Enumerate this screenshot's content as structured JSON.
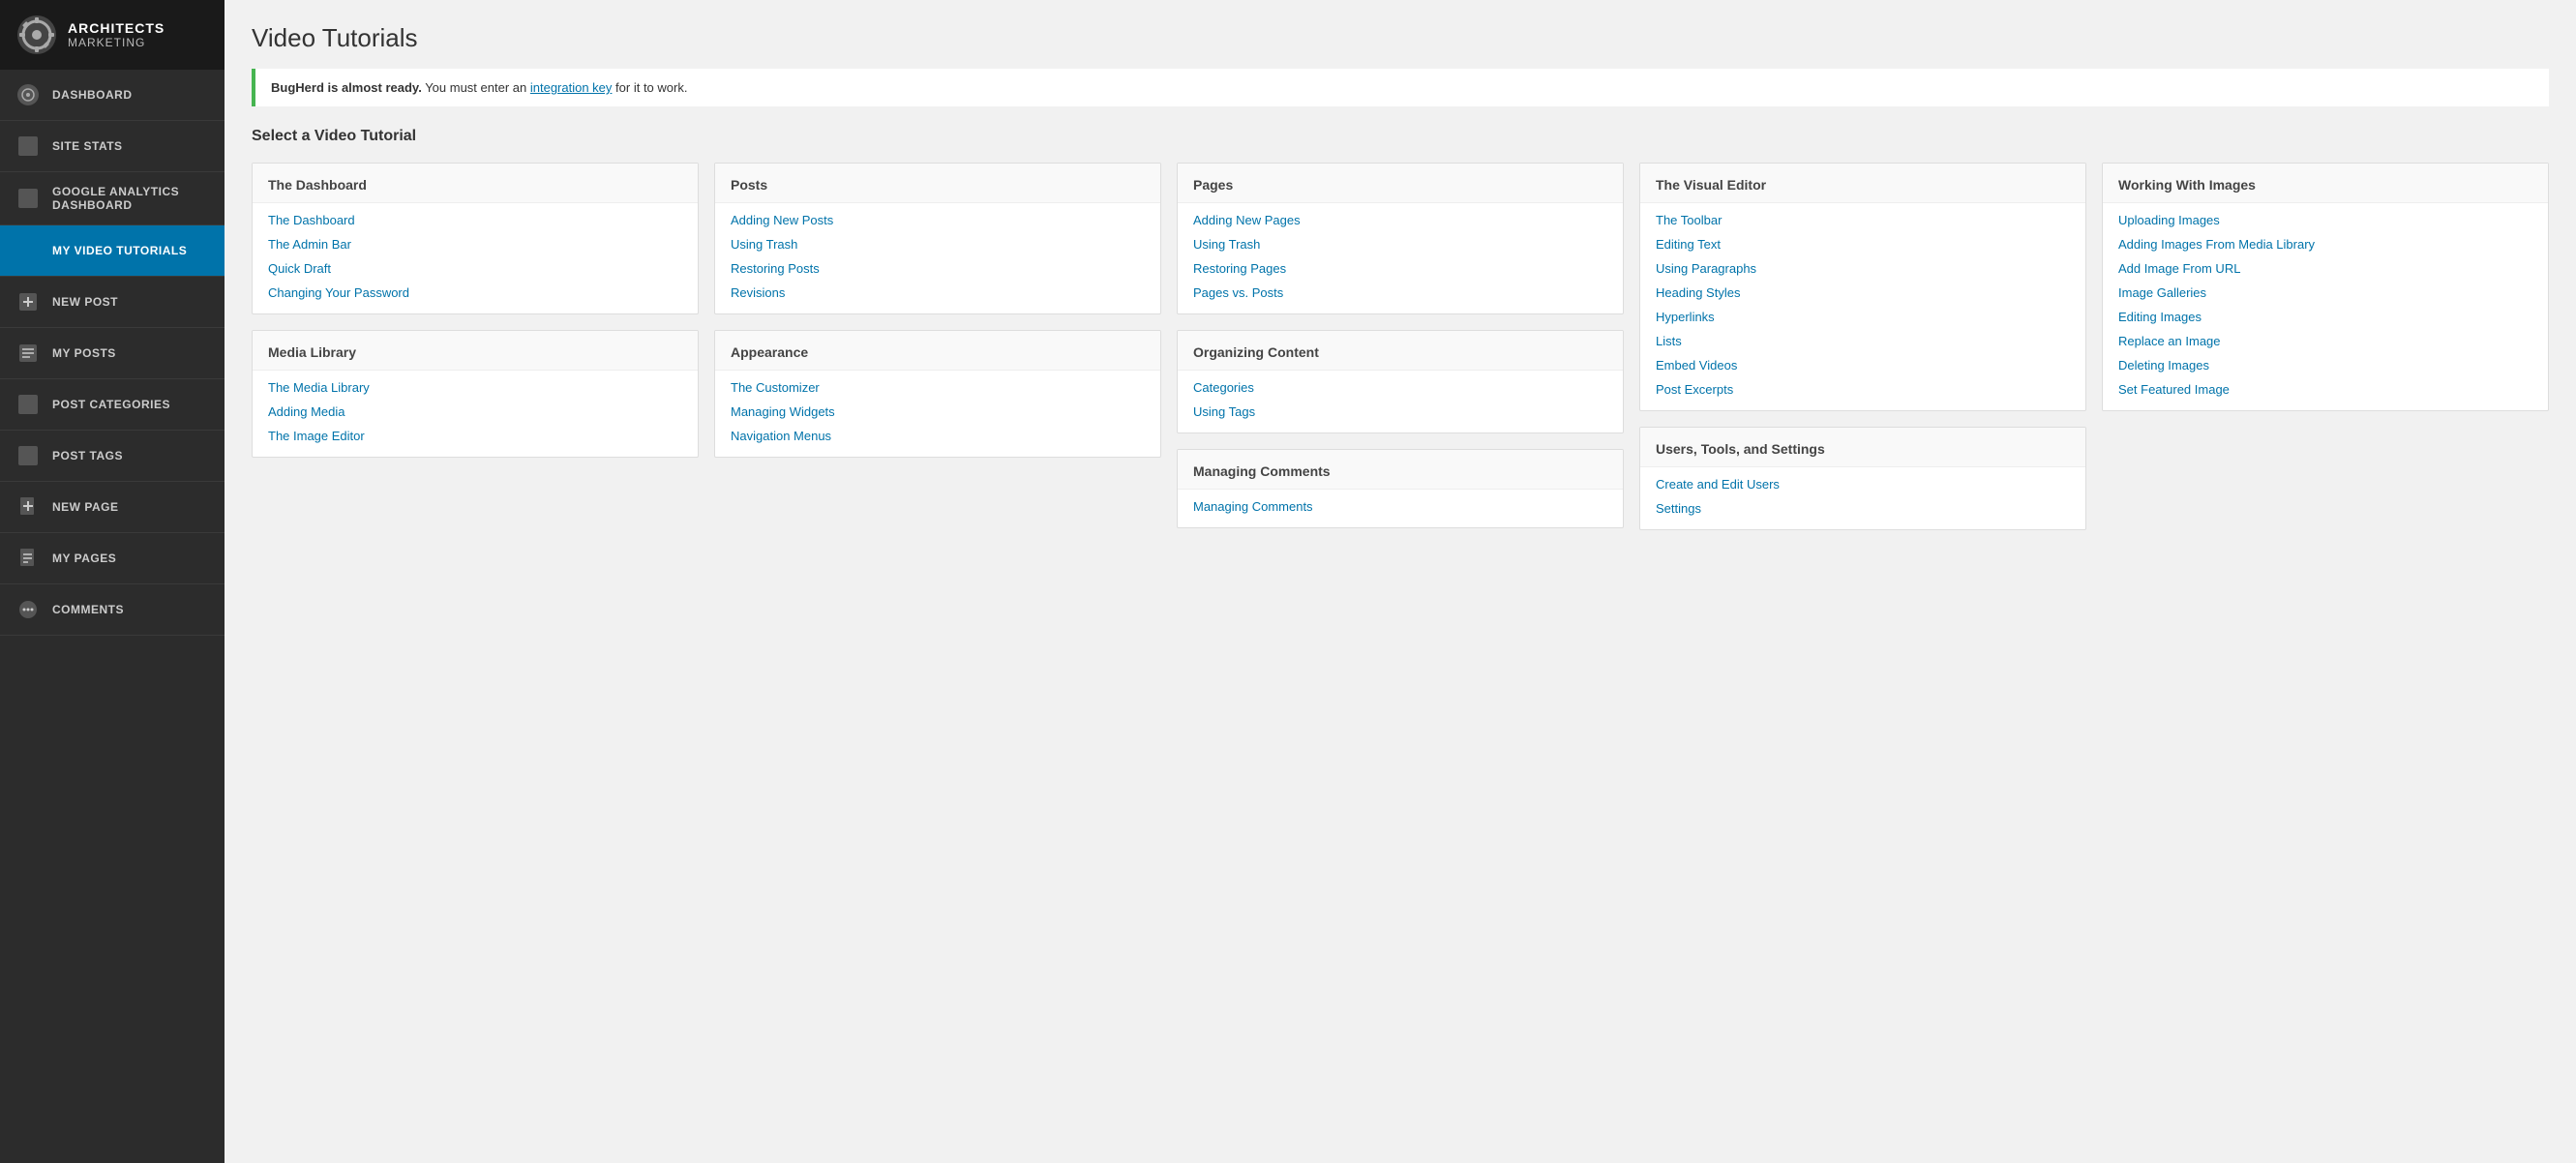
{
  "sidebar": {
    "logo": {
      "line1": "ARCHITECTS",
      "line2": "MARKETING"
    },
    "items": [
      {
        "id": "dashboard",
        "label": "DASHBOARD",
        "icon": "dashboard-icon",
        "active": false
      },
      {
        "id": "site-stats",
        "label": "SITE STATS",
        "icon": "site-stats-icon",
        "active": false
      },
      {
        "id": "google-analytics",
        "label": "GOOGLE ANALYTICS DASHBOARD",
        "icon": "analytics-icon",
        "active": false
      },
      {
        "id": "my-video-tutorials",
        "label": "MY VIDEO TUTORIALS",
        "icon": "video-icon",
        "active": true
      },
      {
        "id": "new-post",
        "label": "NEW POST",
        "icon": "new-post-icon",
        "active": false
      },
      {
        "id": "my-posts",
        "label": "MY POSTS",
        "icon": "my-posts-icon",
        "active": false
      },
      {
        "id": "post-categories",
        "label": "POST CATEGORIES",
        "icon": "post-categories-icon",
        "active": false
      },
      {
        "id": "post-tags",
        "label": "POST TAGS",
        "icon": "post-tags-icon",
        "active": false
      },
      {
        "id": "new-page",
        "label": "NEW PAGE",
        "icon": "new-page-icon",
        "active": false
      },
      {
        "id": "my-pages",
        "label": "MY PAGES",
        "icon": "my-pages-icon",
        "active": false
      },
      {
        "id": "comments",
        "label": "COMMENTS",
        "icon": "comments-icon",
        "active": false
      }
    ]
  },
  "page": {
    "title": "Video Tutorials",
    "notice": {
      "bold": "BugHerd is almost ready.",
      "text": " You must enter an ",
      "link_text": "integration key",
      "text2": " for it to work."
    },
    "select_label": "Select a Video Tutorial"
  },
  "columns": [
    {
      "id": "dashboard-col",
      "sections": [
        {
          "header": "The Dashboard",
          "links": [
            "The Dashboard",
            "The Admin Bar",
            "Quick Draft",
            "Changing Your Password"
          ]
        },
        {
          "header": "Media Library",
          "links": [
            "The Media Library",
            "Adding Media",
            "The Image Editor"
          ]
        }
      ]
    },
    {
      "id": "posts-col",
      "sections": [
        {
          "header": "Posts",
          "links": [
            "Adding New Posts",
            "Using Trash",
            "Restoring Posts",
            "Revisions"
          ]
        },
        {
          "header": "Appearance",
          "links": [
            "The Customizer",
            "Managing Widgets",
            "Navigation Menus"
          ]
        }
      ]
    },
    {
      "id": "pages-col",
      "sections": [
        {
          "header": "Pages",
          "links": [
            "Adding New Pages",
            "Using Trash",
            "Restoring Pages",
            "Pages vs. Posts"
          ]
        },
        {
          "header": "Organizing Content",
          "links": [
            "Categories",
            "Using Tags"
          ]
        },
        {
          "header": "Managing Comments",
          "links": [
            "Managing Comments"
          ]
        }
      ]
    },
    {
      "id": "visual-editor-col",
      "sections": [
        {
          "header": "The Visual Editor",
          "links": [
            "The Toolbar",
            "Editing Text",
            "Using Paragraphs",
            "Heading Styles",
            "Hyperlinks",
            "Lists",
            "Embed Videos",
            "Post Excerpts"
          ]
        },
        {
          "header": "Users, Tools, and Settings",
          "links": [
            "Create and Edit Users",
            "Settings"
          ]
        }
      ]
    },
    {
      "id": "images-col",
      "sections": [
        {
          "header": "Working With Images",
          "links": [
            "Uploading Images",
            "Adding Images From Media Library",
            "Add Image From URL",
            "Image Galleries",
            "Editing Images",
            "Replace an Image",
            "Deleting Images",
            "Set Featured Image"
          ]
        }
      ]
    }
  ]
}
